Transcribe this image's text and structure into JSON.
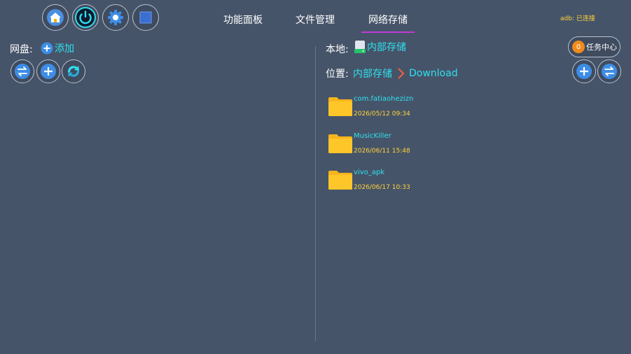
{
  "toolbar": {
    "icons": [
      "home-icon",
      "power-icon",
      "gear-icon",
      "stop-icon"
    ]
  },
  "tabs": [
    {
      "label": "功能面板",
      "active": false
    },
    {
      "label": "文件管理",
      "active": false
    },
    {
      "label": "网络存储",
      "active": true
    }
  ],
  "adb_status": "adb: 已连接",
  "colors": {
    "background": "#465469",
    "accent_cyan": "#2fe0ef",
    "tab_underline": "#c13bd6",
    "date_yellow": "#ffd43a",
    "badge_orange": "#f28a1b",
    "folder_yellow": "#ffc629"
  },
  "left": {
    "netdisk_label": "网盘:",
    "add_label": "添加",
    "buttons": [
      "swap-icon",
      "plus-icon",
      "refresh-icon"
    ]
  },
  "right": {
    "local_label": "本地:",
    "storage_name": "内部存储",
    "location_label": "位置:",
    "breadcrumb": [
      "内部存储",
      "Download"
    ],
    "task_center": {
      "count": "0",
      "label": "任务中心"
    },
    "buttons": [
      "plus-icon",
      "swap-icon"
    ],
    "files": [
      {
        "name": "com.fatiaohezizn",
        "date": "2026/05/12 09:34"
      },
      {
        "name": "MusicKiller",
        "date": "2026/06/11 15:48"
      },
      {
        "name": "vivo_apk",
        "date": "2026/06/17 10:33"
      }
    ]
  }
}
